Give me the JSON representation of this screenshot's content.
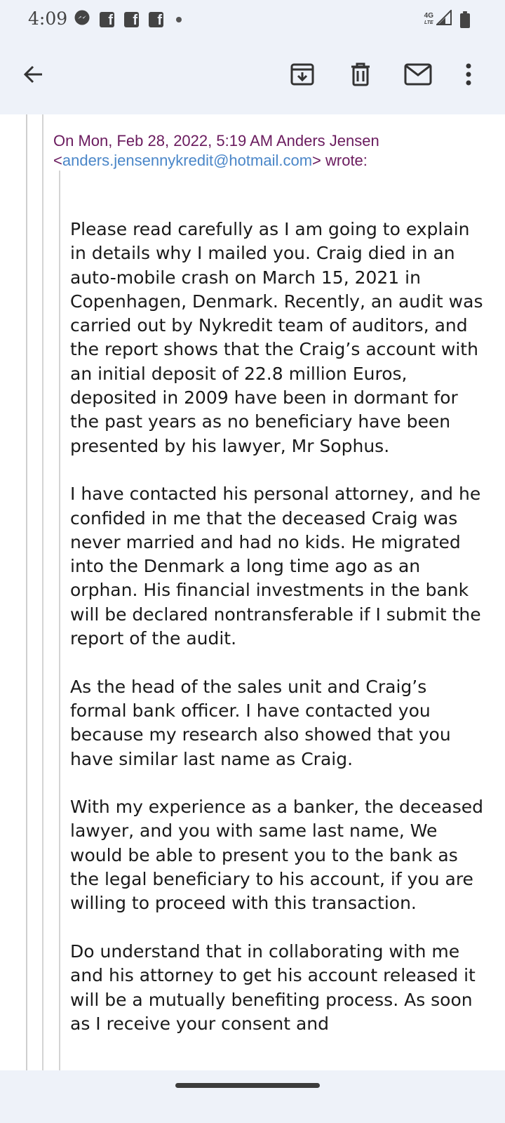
{
  "status_bar": {
    "time": "4:09",
    "network_label": "4G",
    "network_sub": "LTE",
    "icons": [
      "messenger-icon",
      "facebook-icon",
      "facebook-icon",
      "facebook-icon",
      "dot-icon",
      "signal-icon",
      "battery-icon"
    ],
    "fb_letter": "f"
  },
  "app_bar": {
    "actions": [
      "back-arrow-icon",
      "archive-icon",
      "delete-icon",
      "mark-unread-icon",
      "more-vert-icon"
    ]
  },
  "email": {
    "attribution_prefix": "On Mon, Feb 28, 2022, 5:19 AM Anders Jensen <",
    "sender_email": "anders.jensennykredit@hotmail.com",
    "attribution_suffix": "> wrote:",
    "paragraphs": [
      "Please read carefully as I am going to explain in details why I mailed you. Craig died in an auto-mobile crash on March 15, 2021 in Copenhagen, Denmark. Recently, an audit was carried out by Nykredit team of auditors, and the report shows that the Craig’s account with an initial deposit of 22.8 million Euros, deposited in 2009 have been in dormant for the past years as no beneficiary have been presented by his lawyer, Mr Sophus.",
      "I have contacted his personal attorney, and he confided in me that the deceased Craig was never married and had no kids. He migrated into the Denmark a long time ago as an orphan. His financial investments in the bank will be declared nontransferable if I submit the report of the audit.",
      "As the head of the sales unit and Craig’s formal bank officer. I have contacted you because my research also showed that you have similar last name as Craig.",
      "With my experience as a banker, the deceased lawyer, and you with same last name, We would be able to present you to the bank as the legal beneficiary to his account, if you are willing to proceed with this transaction.",
      "Do understand that in collaborating with me and his attorney to get his account released it will be a mutually benefiting process. As soon as I receive your consent and"
    ]
  },
  "colors": {
    "bar_background": "#eef2f9",
    "attribution_text": "#6a1b5e",
    "link": "#4a86c8",
    "body_text": "#1a1a1a"
  }
}
